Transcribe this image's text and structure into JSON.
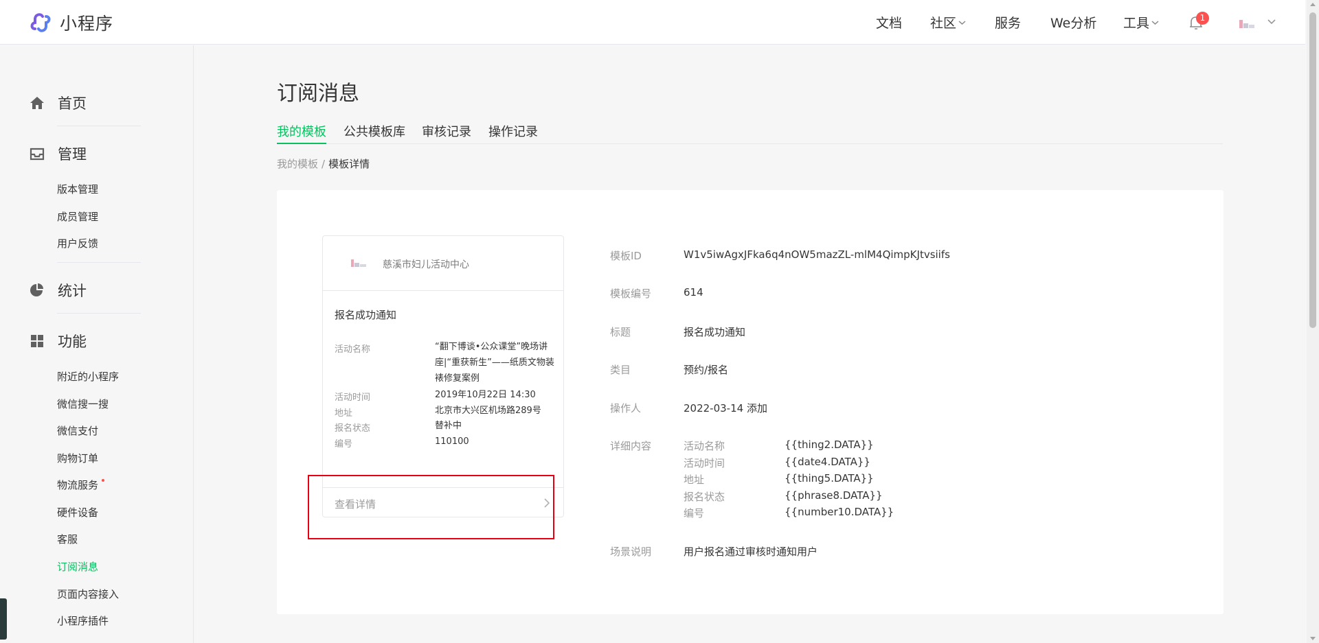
{
  "header": {
    "app_name": "小程序",
    "nav": [
      {
        "label": "文档",
        "dropdown": false
      },
      {
        "label": "社区",
        "dropdown": true
      },
      {
        "label": "服务",
        "dropdown": false
      },
      {
        "label": "We分析",
        "dropdown": false
      },
      {
        "label": "工具",
        "dropdown": true
      }
    ],
    "notification_count": "1",
    "icons": [
      "miniprogram-logo-icon",
      "bell-icon",
      "avatar",
      "chevron-down-icon"
    ]
  },
  "sidebar": {
    "sections": [
      {
        "label": "首页",
        "icon": "home-icon"
      },
      {
        "label": "管理",
        "icon": "inbox-icon"
      },
      {
        "label": "统计",
        "icon": "pie-chart-icon"
      },
      {
        "label": "功能",
        "icon": "grid-icon"
      }
    ],
    "manage_items": [
      "版本管理",
      "成员管理",
      "用户反馈"
    ],
    "feature_items": [
      "附近的小程序",
      "微信搜一搜",
      "微信支付",
      "购物订单",
      "物流服务",
      "硬件设备",
      "客服",
      "订阅消息",
      "页面内容接入",
      "小程序插件"
    ],
    "active_item": "订阅消息"
  },
  "main": {
    "title": "订阅消息",
    "tabs": [
      "我的模板",
      "公共模板库",
      "审核记录",
      "操作记录"
    ],
    "active_tab": "我的模板",
    "breadcrumb": {
      "parent": "我的模板",
      "separator": "/",
      "current": "模板详情"
    }
  },
  "preview": {
    "org_name": "慈溪市妇儿活动中心",
    "title": "报名成功通知",
    "fields": [
      {
        "label": "活动名称",
        "value": "“翻下博谈•公众课堂”晚场讲座|“重获新生”——纸质文物装裱修复案例"
      },
      {
        "label": "活动时间",
        "value": "2019年10月22日 14:30"
      },
      {
        "label": "地址",
        "value": "北京市大兴区机场路289号"
      },
      {
        "label": "报名状态",
        "value": "替补中"
      },
      {
        "label": "编号",
        "value": "110100"
      }
    ],
    "footer_link": "查看详情"
  },
  "detail": {
    "template_id_label": "模板ID",
    "template_id": "W1v5iwAgxJFka6q4nOW5mazZL-mlM4QimpKJtvsiifs",
    "number_label": "模板编号",
    "number": "614",
    "title_label": "标题",
    "title": "报名成功通知",
    "category_label": "类目",
    "category": "预约/报名",
    "operator_label": "操作人",
    "operator": "2022-03-14 添加",
    "content_label": "详细内容",
    "content": [
      {
        "label": "活动名称",
        "value": "{{thing2.DATA}}"
      },
      {
        "label": "活动时间",
        "value": "{{date4.DATA}}"
      },
      {
        "label": "地址",
        "value": "{{thing5.DATA}}"
      },
      {
        "label": "报名状态",
        "value": "{{phrase8.DATA}}"
      },
      {
        "label": "编号",
        "value": "{{number10.DATA}}"
      }
    ],
    "scene_label": "场景说明",
    "scene": "用户报名通过审核时通知用户"
  },
  "colors": {
    "accent": "#07c160",
    "badge": "#fa5151",
    "highlight_box": "#e60012",
    "text": "#353535",
    "muted": "#9a9a9a"
  }
}
